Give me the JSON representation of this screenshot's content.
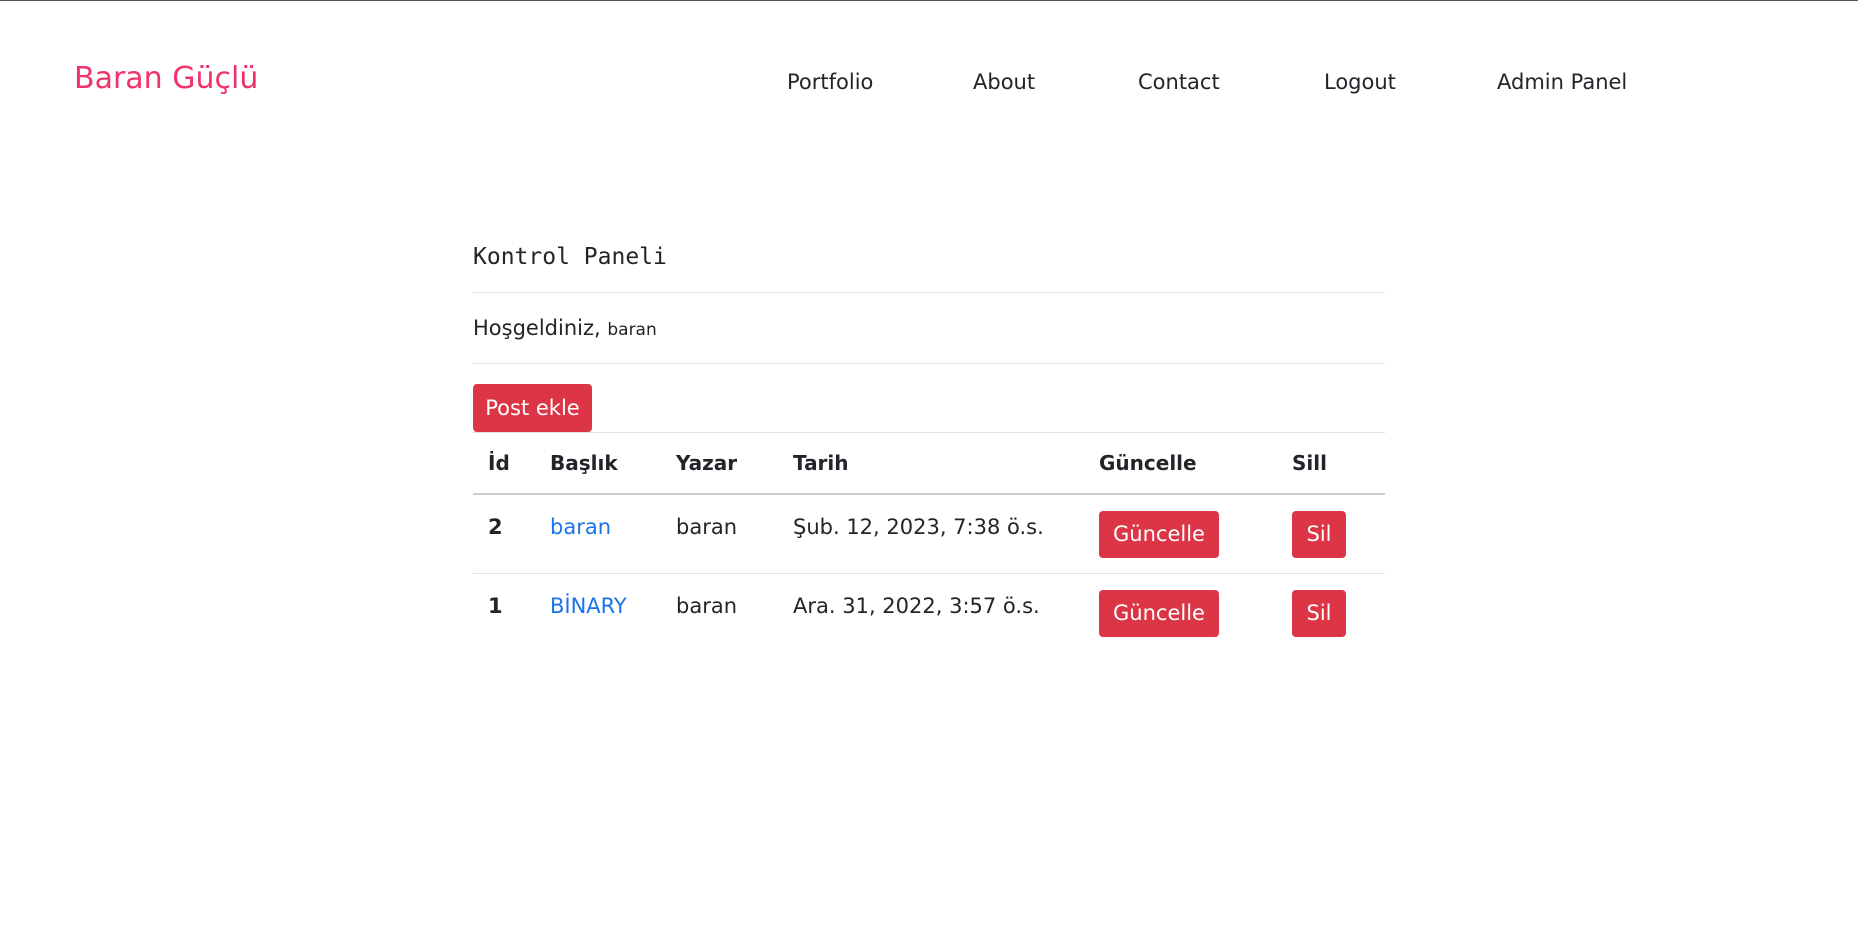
{
  "header": {
    "brand": "Baran Güçlü",
    "nav": [
      {
        "label": "Portfolio"
      },
      {
        "label": "About"
      },
      {
        "label": "Contact"
      },
      {
        "label": "Logout"
      },
      {
        "label": "Admin Panel"
      }
    ]
  },
  "colors": {
    "brand": "#f0346b",
    "danger": "#dc3545",
    "link": "#1a73e8"
  },
  "main": {
    "title": "Kontrol Paneli",
    "welcome_text": "Hoşgeldiniz,",
    "username": "baran",
    "add_post_label": "Post ekle",
    "table": {
      "headers": [
        "İd",
        "Başlık",
        "Yazar",
        "Tarih",
        "Güncelle",
        "Sill"
      ],
      "rows": [
        {
          "id": "2",
          "title": "baran",
          "author": "baran",
          "date": "Şub. 12, 2023, 7:38 ö.s.",
          "update_label": "Güncelle",
          "delete_label": "Sil"
        },
        {
          "id": "1",
          "title": "BİNARY",
          "author": "baran",
          "date": "Ara. 31, 2022, 3:57 ö.s.",
          "update_label": "Güncelle",
          "delete_label": "Sil"
        }
      ]
    }
  }
}
